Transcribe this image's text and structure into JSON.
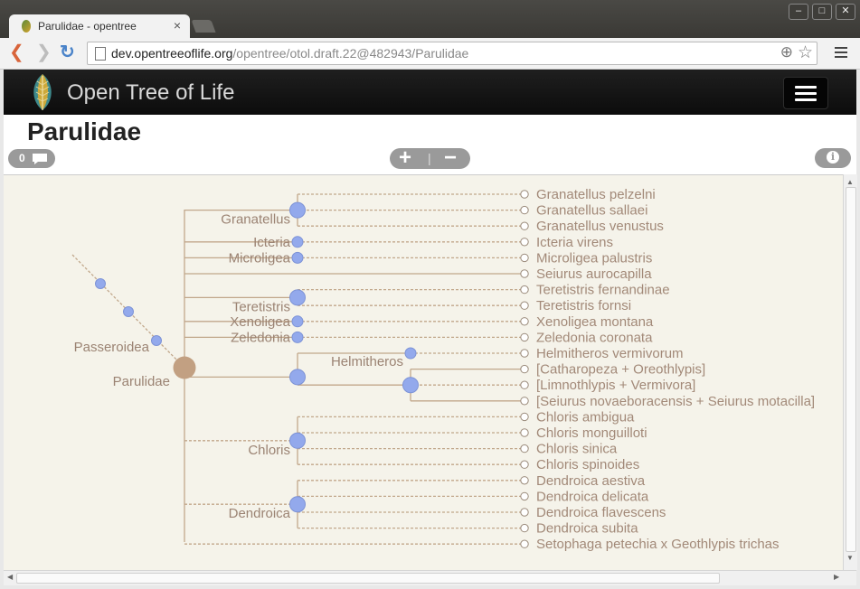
{
  "browser": {
    "tab_title": "Parulidae - opentree",
    "tab_close": "×",
    "url_host": "dev.opentreeoflife.org",
    "url_path": "/opentree/otol.draft.22@482943/Parulidae",
    "win_min": "–",
    "win_max": "□",
    "win_close": "✕",
    "back": "❮",
    "forward": "❯",
    "reload": "↻",
    "zoom": "⊕",
    "star": "☆"
  },
  "app": {
    "brand": "Open Tree of Life",
    "page_title": "Parulidae",
    "comment_count": "0",
    "zoom_in": "+",
    "zoom_out": "−",
    "zoom_sep": "|",
    "info": "i"
  },
  "tree": {
    "colors": {
      "edge": "#c1a78b",
      "node": "#93a9ec",
      "node_stroke": "#7d93d6",
      "root_node": "#c2a082",
      "label": "#9b8373",
      "tip": "#a28978"
    },
    "ancestors": [
      "Passeroidea"
    ],
    "root_label": "Parulidae",
    "clades": [
      "Granatellus",
      "Icteria",
      "Microligea",
      "Teretistris",
      "Xenoligea",
      "Zeledonia",
      "Helmitheros",
      "Chloris",
      "Dendroica"
    ],
    "tips": [
      "Granatellus pelzelni",
      "Granatellus sallaei",
      "Granatellus venustus",
      "Icteria virens",
      "Microligea palustris",
      "Seiurus aurocapilla",
      "Teretistris fernandinae",
      "Teretistris fornsi",
      "Xenoligea montana",
      "Zeledonia coronata",
      "Helmitheros vermivorum",
      "[Catharopeza + Oreothlypis]",
      "[Limnothlypis + Vermivora]",
      "[Seiurus novaeboracensis + Seiurus motacilla]",
      "Chloris ambigua",
      "Chloris monguilloti",
      "Chloris sinica",
      "Chloris spinoides",
      "Dendroica aestiva",
      "Dendroica delicata",
      "Dendroica flavescens",
      "Dendroica subita",
      "Setophaga petechia x Geothlypis trichas"
    ]
  }
}
